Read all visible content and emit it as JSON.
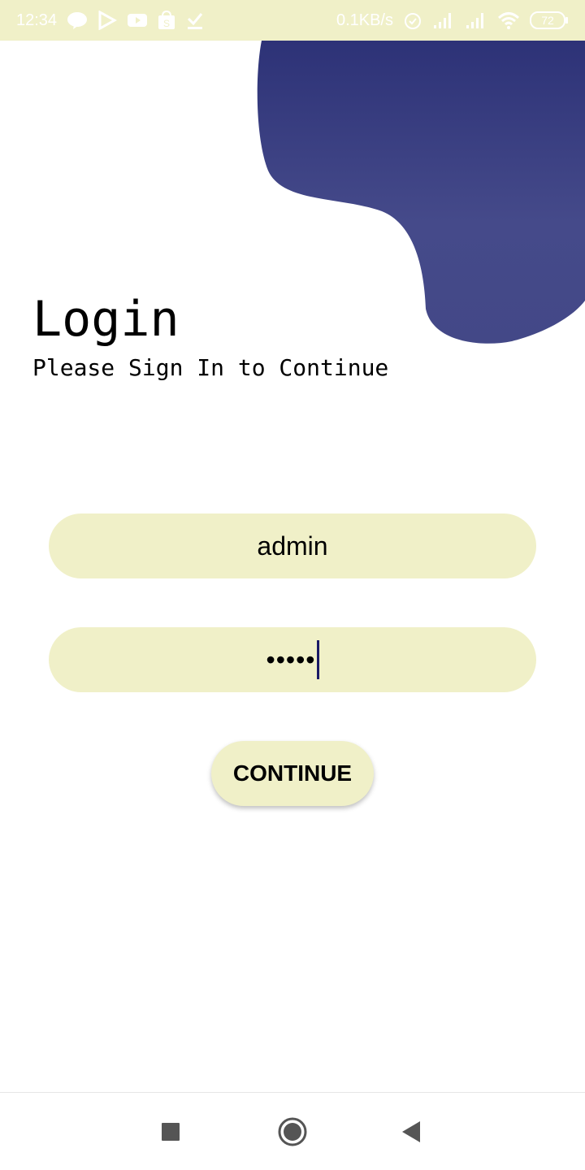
{
  "status_bar": {
    "time": "12:34",
    "network_speed": "0.1KB/s",
    "battery_level": "72",
    "background_color": "#f0f0c8",
    "icons_left": [
      "line-icon",
      "play-store-icon",
      "youtube-icon",
      "shopee-icon",
      "download-done-icon"
    ],
    "icons_right": [
      "alarm-icon",
      "signal-icon",
      "signal-icon",
      "wifi-icon",
      "battery-icon"
    ]
  },
  "header": {
    "title": "Login",
    "subtitle": "Please Sign In to Continue",
    "blob_color": "#3a3f84"
  },
  "form": {
    "username_value": "admin",
    "password_value": "•••••",
    "field_color": "#f0f0c8"
  },
  "actions": {
    "continue_label": "CONTINUE"
  },
  "nav_bar": {
    "icons": [
      "recents-icon",
      "home-icon",
      "back-icon"
    ]
  }
}
